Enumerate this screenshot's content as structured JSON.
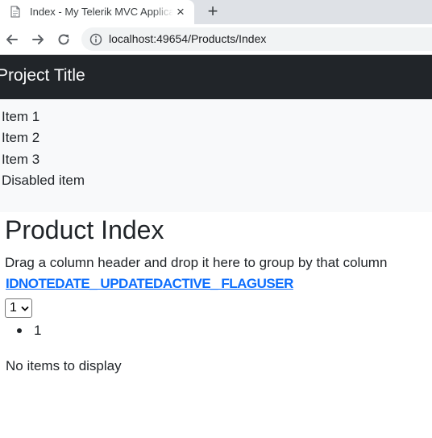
{
  "browser": {
    "tab_title": "Index - My Telerik MVC Application",
    "new_tab_symbol": "+",
    "close_symbol": "×",
    "url": "localhost:49654/Products/Index"
  },
  "navbar": {
    "brand": "Project Title"
  },
  "menu": {
    "items": [
      {
        "label": "Item 1"
      },
      {
        "label": "Item 2"
      },
      {
        "label": "Item 3"
      },
      {
        "label": "Disabled item"
      }
    ]
  },
  "main": {
    "title": "Product Index",
    "group_hint": "Drag a column header and drop it here to group by that column",
    "columns": [
      "ID",
      "NOTE",
      "DATE_ UPDATED",
      "ACTIVE_ FLAG",
      "USER"
    ],
    "page_size_value": "1",
    "pages": [
      "1"
    ],
    "empty_message": "No items to display"
  }
}
